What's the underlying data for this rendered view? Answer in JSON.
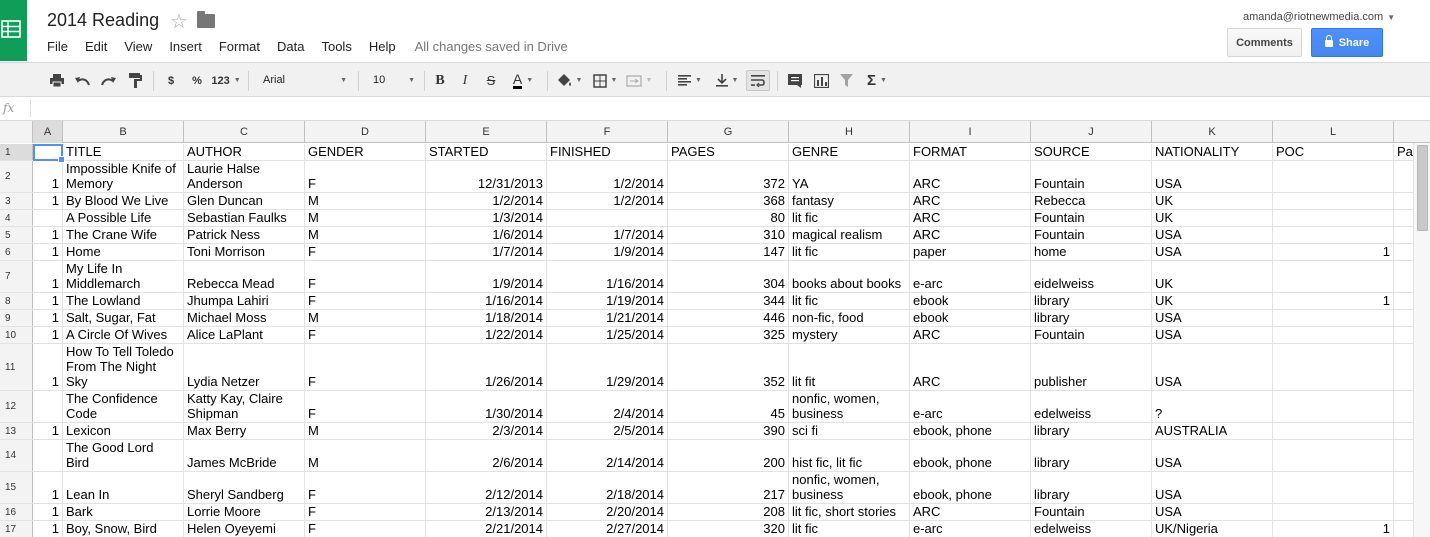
{
  "app": {
    "title": "2014 Reading",
    "account": "amanda@riotnewmedia.com",
    "comments_label": "Comments",
    "share_label": "Share",
    "accent_color": "#4d90fe",
    "logo_color": "#0f9d58"
  },
  "menu": {
    "items": [
      "File",
      "Edit",
      "View",
      "Insert",
      "Format",
      "Data",
      "Tools",
      "Help"
    ],
    "status": "All changes saved in Drive"
  },
  "toolbar": {
    "currency_label": "$",
    "percent_label": "%",
    "format_label": "123",
    "font_name": "Arial",
    "font_size": "10",
    "bold_label": "B",
    "italic_label": "I",
    "strike_label": "S",
    "text_color_label": "A",
    "sum_label": "Σ"
  },
  "formula_bar": {
    "fx_label": "fx",
    "value": ""
  },
  "columns": [
    "A",
    "B",
    "C",
    "D",
    "E",
    "F",
    "G",
    "H",
    "I",
    "J",
    "K",
    "L"
  ],
  "rows": [
    {
      "n": "1",
      "cells": [
        "",
        "TITLE",
        "AUTHOR",
        "GENDER",
        "STARTED",
        "FINISHED",
        "PAGES",
        "GENRE",
        "FORMAT",
        "SOURCE",
        "NATIONALITY",
        "POC",
        "Pa"
      ]
    },
    {
      "n": "2",
      "cells": [
        "1",
        "Impossible Knife of\nMemory",
        "Laurie Halse\nAnderson",
        "F",
        "12/31/2013",
        "1/2/2014",
        "372",
        "YA",
        "ARC",
        "Fountain",
        "USA",
        "",
        ""
      ]
    },
    {
      "n": "3",
      "cells": [
        "1",
        "By Blood We Live",
        "Glen Duncan",
        "M",
        "1/2/2014",
        "1/2/2014",
        "368",
        "fantasy",
        "ARC",
        "Rebecca",
        "UK",
        "",
        ""
      ]
    },
    {
      "n": "4",
      "cells": [
        "",
        "A Possible Life",
        "Sebastian Faulks",
        "M",
        "1/3/2014",
        "",
        "80",
        "lit fic",
        "ARC",
        "Fountain",
        "UK",
        "",
        ""
      ]
    },
    {
      "n": "5",
      "cells": [
        "1",
        "The Crane Wife",
        "Patrick Ness",
        "M",
        "1/6/2014",
        "1/7/2014",
        "310",
        "magical realism",
        "ARC",
        "Fountain",
        "USA",
        "",
        ""
      ]
    },
    {
      "n": "6",
      "cells": [
        "1",
        "Home",
        "Toni Morrison",
        "F",
        "1/7/2014",
        "1/9/2014",
        "147",
        "lit fic",
        "paper",
        "home",
        "USA",
        "1",
        ""
      ]
    },
    {
      "n": "7",
      "cells": [
        "1",
        "My Life In\nMiddlemarch",
        "Rebecca Mead",
        "F",
        "1/9/2014",
        "1/16/2014",
        "304",
        "books about books",
        "e-arc",
        "eidelweiss",
        "UK",
        "",
        ""
      ]
    },
    {
      "n": "8",
      "cells": [
        "1",
        "The Lowland",
        "Jhumpa Lahiri",
        "F",
        "1/16/2014",
        "1/19/2014",
        "344",
        "lit fic",
        "ebook",
        "library",
        "UK",
        "1",
        ""
      ]
    },
    {
      "n": "9",
      "cells": [
        "1",
        "Salt, Sugar, Fat",
        "Michael Moss",
        "M",
        "1/18/2014",
        "1/21/2014",
        "446",
        "non-fic, food",
        "ebook",
        "library",
        "USA",
        "",
        ""
      ]
    },
    {
      "n": "10",
      "cells": [
        "1",
        "A Circle Of Wives",
        "Alice LaPlant",
        "F",
        "1/22/2014",
        "1/25/2014",
        "325",
        "mystery",
        "ARC",
        "Fountain",
        "USA",
        "",
        ""
      ]
    },
    {
      "n": "11",
      "cells": [
        "1",
        "How To Tell Toledo\nFrom The Night\nSky",
        "Lydia Netzer",
        "F",
        "1/26/2014",
        "1/29/2014",
        "352",
        "lit fit",
        "ARC",
        "publisher",
        "USA",
        "",
        ""
      ]
    },
    {
      "n": "12",
      "cells": [
        "",
        "The Confidence\nCode",
        "Katty Kay, Claire\nShipman",
        "F",
        "1/30/2014",
        "2/4/2014",
        "45",
        "nonfic, women,\nbusiness",
        "e-arc",
        "edelweiss",
        "?",
        "",
        ""
      ]
    },
    {
      "n": "13",
      "cells": [
        "1",
        "Lexicon",
        "Max Berry",
        "M",
        "2/3/2014",
        "2/5/2014",
        "390",
        "sci fi",
        "ebook, phone",
        "library",
        "AUSTRALIA",
        "",
        ""
      ]
    },
    {
      "n": "14",
      "cells": [
        "",
        "The Good Lord\nBird",
        "James McBride",
        "M",
        "2/6/2014",
        "2/14/2014",
        "200",
        "hist fic, lit fic",
        "ebook, phone",
        "library",
        "USA",
        "",
        ""
      ]
    },
    {
      "n": "15",
      "cells": [
        "1",
        "Lean In",
        "Sheryl Sandberg",
        "F",
        "2/12/2014",
        "2/18/2014",
        "217",
        "nonfic, women,\nbusiness",
        "ebook, phone",
        "library",
        "USA",
        "",
        ""
      ]
    },
    {
      "n": "16",
      "cells": [
        "1",
        "Bark",
        "Lorrie Moore",
        "F",
        "2/13/2014",
        "2/20/2014",
        "208",
        "lit fic, short stories",
        "ARC",
        "Fountain",
        "USA",
        "",
        ""
      ]
    },
    {
      "n": "17",
      "cells": [
        "1",
        "Boy, Snow, Bird",
        "Helen Oyeyemi",
        "F",
        "2/21/2014",
        "2/27/2014",
        "320",
        "lit fic",
        "e-arc",
        "edelweiss",
        "UK/Nigeria",
        "1",
        ""
      ]
    }
  ]
}
